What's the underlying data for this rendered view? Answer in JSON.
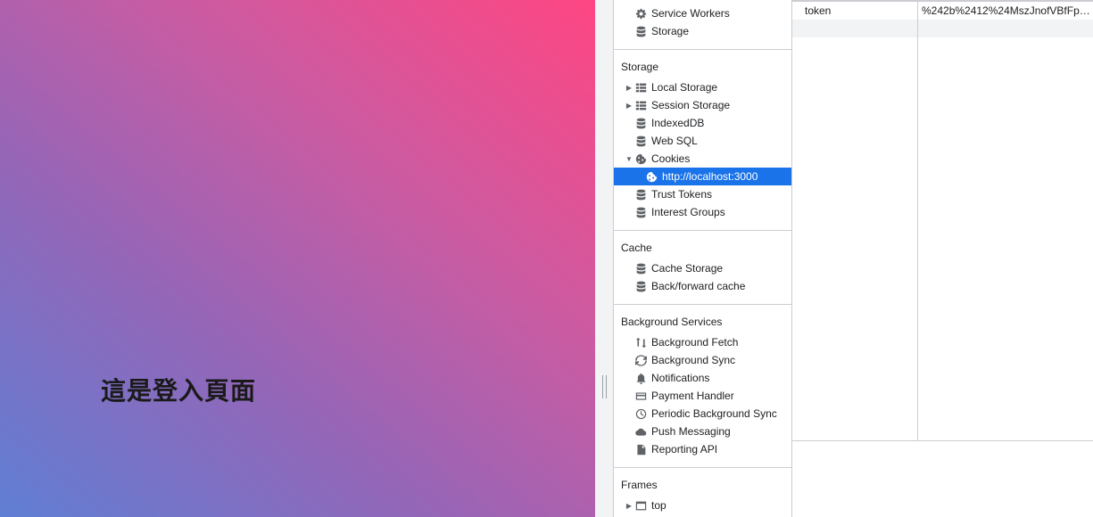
{
  "page": {
    "heading": "這是登入頁面"
  },
  "sidebar": {
    "application": [
      {
        "label": "Service Workers",
        "icon": "gear-icon"
      },
      {
        "label": "Storage",
        "icon": "database-icon"
      }
    ],
    "storage": {
      "title": "Storage",
      "items": [
        {
          "label": "Local Storage",
          "icon": "grid-icon",
          "expandable": true
        },
        {
          "label": "Session Storage",
          "icon": "grid-icon",
          "expandable": true
        },
        {
          "label": "IndexedDB",
          "icon": "database-icon"
        },
        {
          "label": "Web SQL",
          "icon": "database-icon"
        },
        {
          "label": "Cookies",
          "icon": "cookie-icon",
          "expanded": true
        },
        {
          "label": "http://localhost:3000",
          "icon": "cookie-icon",
          "selected": true
        },
        {
          "label": "Trust Tokens",
          "icon": "database-icon"
        },
        {
          "label": "Interest Groups",
          "icon": "database-icon"
        }
      ]
    },
    "cache": {
      "title": "Cache",
      "items": [
        {
          "label": "Cache Storage",
          "icon": "database-icon"
        },
        {
          "label": "Back/forward cache",
          "icon": "database-icon"
        }
      ]
    },
    "background_services": {
      "title": "Background Services",
      "items": [
        {
          "label": "Background Fetch",
          "icon": "up-down-arrows-icon"
        },
        {
          "label": "Background Sync",
          "icon": "sync-icon"
        },
        {
          "label": "Notifications",
          "icon": "bell-icon"
        },
        {
          "label": "Payment Handler",
          "icon": "card-icon"
        },
        {
          "label": "Periodic Background Sync",
          "icon": "clock-icon"
        },
        {
          "label": "Push Messaging",
          "icon": "cloud-icon"
        },
        {
          "label": "Reporting API",
          "icon": "file-icon"
        }
      ]
    },
    "frames": {
      "title": "Frames",
      "items": [
        {
          "label": "top",
          "icon": "frame-icon",
          "expandable": true
        }
      ]
    }
  },
  "cookie_table": {
    "rows": [
      {
        "name": "token",
        "value": "%242b%2412%24MszJnofVBfFpb..."
      }
    ]
  },
  "colors": {
    "selection": "#1a73e8",
    "icon": "#5f6368",
    "divider": "#cbcdd1"
  }
}
